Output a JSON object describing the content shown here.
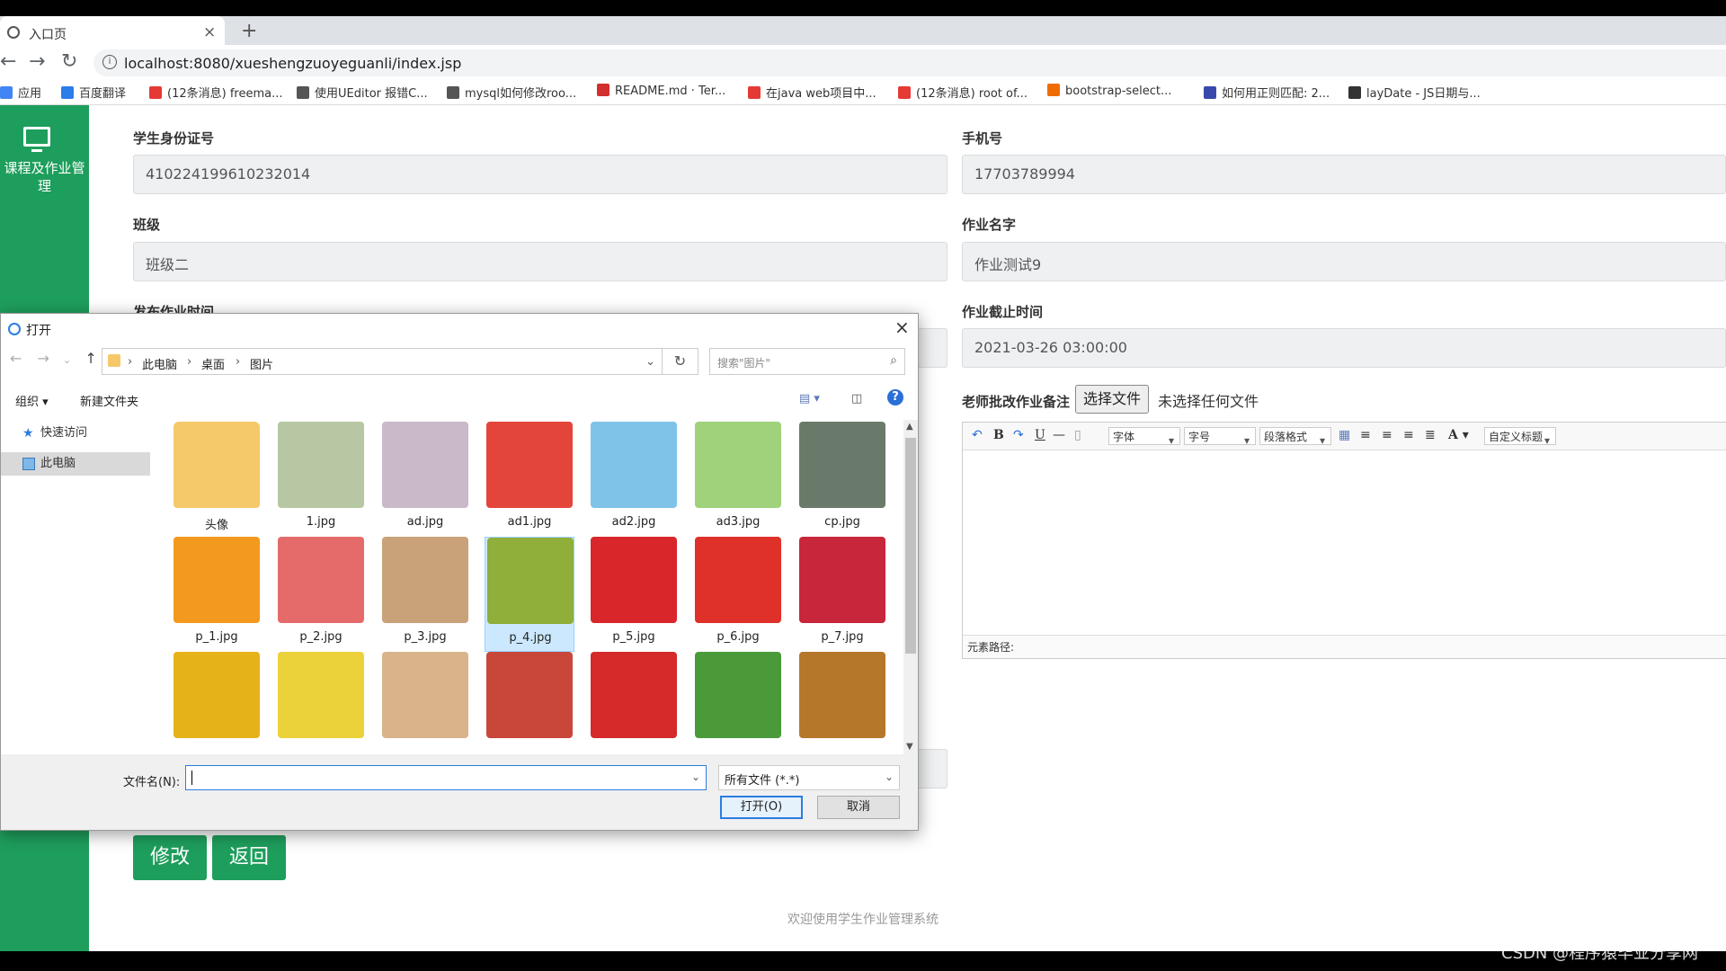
{
  "browser": {
    "tab_title": "入口页",
    "new_tab": "+",
    "url": "localhost:8080/xueshengzuoyeguanli/index.jsp",
    "bookmarks": [
      {
        "label": "应用",
        "color": "#4285f4"
      },
      {
        "label": "百度翻译",
        "color": "#2b7de9"
      },
      {
        "label": "(12条消息) freema...",
        "color": "#e53935"
      },
      {
        "label": "使用UEditor 报错C...",
        "color": "#555555"
      },
      {
        "label": "mysql如何修改roo...",
        "color": "#555555"
      },
      {
        "label": "README.md · Ter...",
        "color": "#d32f2f"
      },
      {
        "label": "在java web项目中...",
        "color": "#e53935"
      },
      {
        "label": "(12条消息) root of...",
        "color": "#e53935"
      },
      {
        "label": "bootstrap-select...",
        "color": "#ef6c00"
      },
      {
        "label": "如何用正则匹配: 2...",
        "color": "#3949ab"
      },
      {
        "label": "layDate - JS日期与...",
        "color": "#333333"
      }
    ]
  },
  "sidebar": {
    "label": "课程及作业管理",
    "icon": "monitor-icon"
  },
  "form": {
    "id_label": "学生身份证号",
    "id_value": "410224199610232014",
    "phone_label": "手机号",
    "phone_value": "17703789994",
    "class_label": "班级",
    "class_value": "班级二",
    "hw_label": "作业名字",
    "hw_value": "作业测试9",
    "publish_label": "发布作业时间",
    "deadline_label": "作业截止时间",
    "deadline_value": "2021-03-26 03:00:00",
    "remark_label": "老师批改作业备注",
    "choose_file": "选择文件",
    "no_file": "未选择任何文件",
    "edit_btn": "修改",
    "back_btn": "返回"
  },
  "editor": {
    "font": "字体",
    "size": "字号",
    "para": "段落格式",
    "custom": "自定义标题",
    "path": "元素路径:"
  },
  "footer": "欢迎使用学生作业管理系统",
  "watermark": "CSDN @程序猿毕业分享网",
  "dialog": {
    "title": "打开",
    "crumbs": [
      "此电脑",
      "桌面",
      "图片"
    ],
    "search_placeholder": "搜索\"图片\"",
    "organize": "组织 ▾",
    "new_folder": "新建文件夹",
    "quick_access": "快速访问",
    "this_pc": "此电脑",
    "files": [
      {
        "name": "头像",
        "color": "#f5c96a"
      },
      {
        "name": "1.jpg",
        "color": "#b7c7a3"
      },
      {
        "name": "ad.jpg",
        "color": "#c9b9c9"
      },
      {
        "name": "ad1.jpg",
        "color": "#e4453a"
      },
      {
        "name": "ad2.jpg",
        "color": "#7fc3e8"
      },
      {
        "name": "ad3.jpg",
        "color": "#9fd27a"
      },
      {
        "name": "cp.jpg",
        "color": "#6a7a6a"
      },
      {
        "name": "p_1.jpg",
        "color": "#f39a1e"
      },
      {
        "name": "p_2.jpg",
        "color": "#e56b6b"
      },
      {
        "name": "p_3.jpg",
        "color": "#c9a27a"
      },
      {
        "name": "p_4.jpg",
        "color": "#8fae3a"
      },
      {
        "name": "p_5.jpg",
        "color": "#d8262a"
      },
      {
        "name": "p_6.jpg",
        "color": "#e0302a"
      },
      {
        "name": "p_7.jpg",
        "color": "#c8263a"
      },
      {
        "name": "",
        "color": "#e5b21a"
      },
      {
        "name": "",
        "color": "#ecd23a"
      },
      {
        "name": "",
        "color": "#d9b38a"
      },
      {
        "name": "",
        "color": "#c9473a"
      },
      {
        "name": "",
        "color": "#d42a2a"
      },
      {
        "name": "",
        "color": "#4a9a3a"
      },
      {
        "name": "",
        "color": "#b5772a"
      }
    ],
    "filename_label": "文件名(N):",
    "filetype": "所有文件 (*.*)",
    "open_btn": "打开(O)",
    "cancel_btn": "取消"
  }
}
